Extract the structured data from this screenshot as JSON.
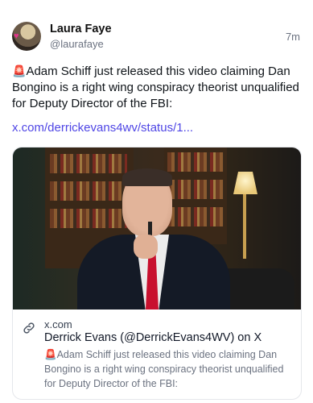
{
  "author": {
    "name": "Laura Faye",
    "handle": "@laurafaye"
  },
  "post": {
    "time": "7m",
    "siren_icon": "🚨",
    "text": "Adam Schiff just released this video claiming Dan Bongino is a right wing conspiracy theorist unqualified for Deputy Director of the FBI:",
    "link": "x.com/derrickevans4wv/status/1..."
  },
  "card": {
    "domain": "x.com",
    "title": "Derrick Evans (@DerrickEvans4WV) on X",
    "siren_icon": "🚨",
    "description": "Adam Schiff just released this video claiming Dan Bongino is a right wing conspiracy theorist unqualified for Deputy Director of the FBI:"
  },
  "colors": {
    "link": "#4f46e5",
    "muted": "#6b7280"
  }
}
